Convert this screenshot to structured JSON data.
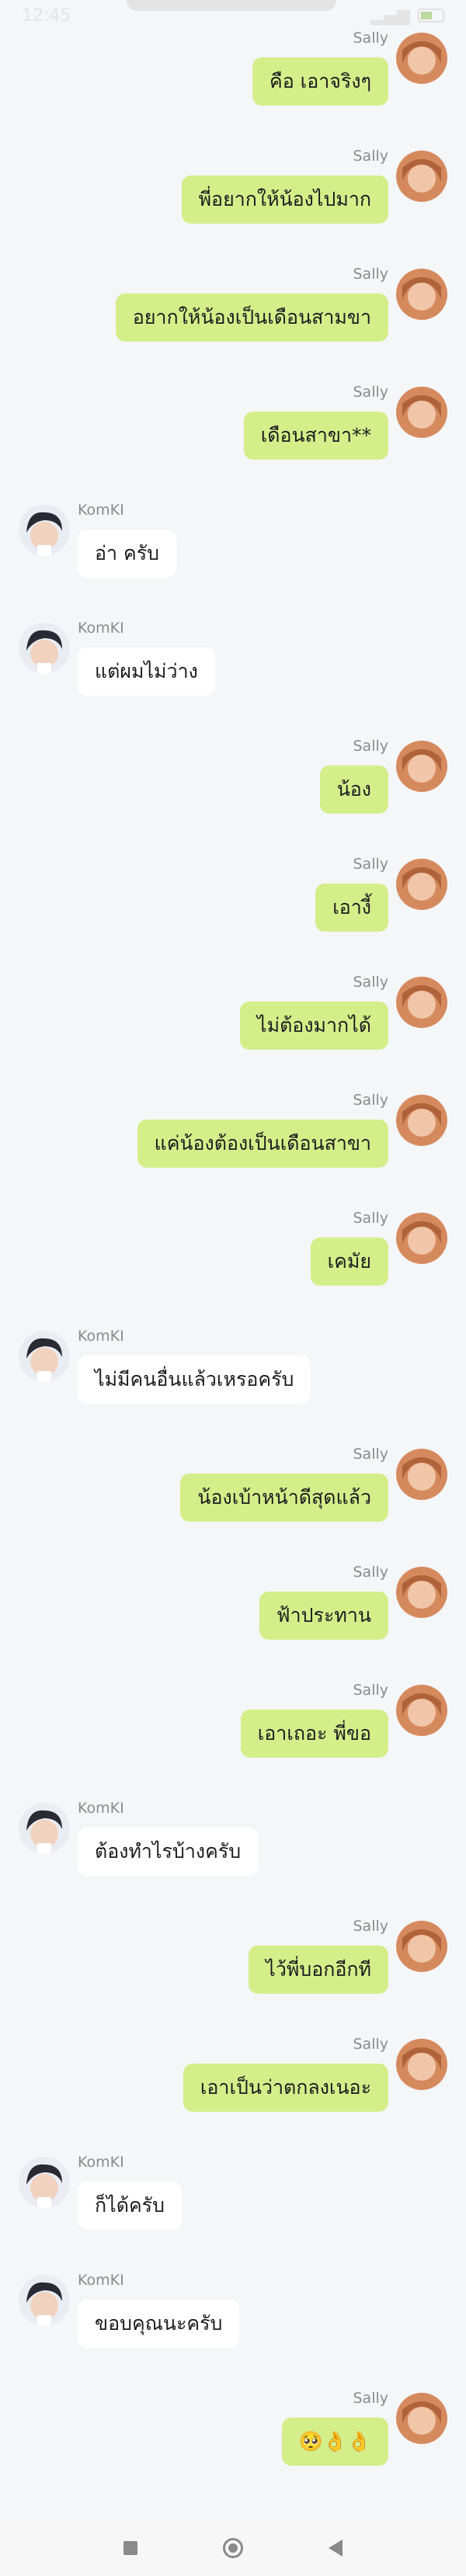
{
  "status_bar": {
    "time": "12:45",
    "right": ""
  },
  "contacts": {
    "sally": "Sally",
    "komki": "KomKI"
  },
  "messages": [
    {
      "side": "right",
      "sender": "Sally",
      "text": "คือ เอาจริงๆ"
    },
    {
      "side": "right",
      "sender": "Sally",
      "text": "พี่อยากให้น้องไปมาก"
    },
    {
      "side": "right",
      "sender": "Sally",
      "text": "อยากให้น้องเป็นเดือนสามขา"
    },
    {
      "side": "right",
      "sender": "Sally",
      "text": "เดือนสาขา**"
    },
    {
      "side": "left",
      "sender": "KomKI",
      "text": "อ่า ครับ"
    },
    {
      "side": "left",
      "sender": "KomKI",
      "text": "แต่ผมไม่ว่าง"
    },
    {
      "side": "right",
      "sender": "Sally",
      "text": "น้อง"
    },
    {
      "side": "right",
      "sender": "Sally",
      "text": "เอางี้"
    },
    {
      "side": "right",
      "sender": "Sally",
      "text": "ไม่ต้องมากได้"
    },
    {
      "side": "right",
      "sender": "Sally",
      "text": "แค่น้องต้องเป็นเดือนสาขา"
    },
    {
      "side": "right",
      "sender": "Sally",
      "text": "เคมัย"
    },
    {
      "side": "left",
      "sender": "KomKI",
      "text": "ไม่มีคนอื่นแล้วเหรอครับ"
    },
    {
      "side": "right",
      "sender": "Sally",
      "text": "น้องเบ้าหน้าดีสุดแล้ว"
    },
    {
      "side": "right",
      "sender": "Sally",
      "text": "ฟ้าประทาน"
    },
    {
      "side": "right",
      "sender": "Sally",
      "text": "เอาเถอะ พี่ขอ"
    },
    {
      "side": "left",
      "sender": "KomKI",
      "text": "ต้องทำไรบ้างครับ"
    },
    {
      "side": "right",
      "sender": "Sally",
      "text": "ไว้พี่บอกอีกที"
    },
    {
      "side": "right",
      "sender": "Sally",
      "text": "เอาเป็นว่าตกลงเนอะ"
    },
    {
      "side": "left",
      "sender": "KomKI",
      "text": "ก็ได้ครับ"
    },
    {
      "side": "left",
      "sender": "KomKI",
      "text": "ขอบคุณนะครับ"
    },
    {
      "side": "right",
      "sender": "Sally",
      "text": "🥺👌👌"
    }
  ],
  "colors": {
    "outgoing_bubble": "#d4ee8a",
    "incoming_bubble": "#ffffff",
    "background": "#f5f6f8"
  },
  "nav": {
    "recent_icon": "square-icon",
    "home_icon": "circle-icon",
    "back_icon": "triangle-back-icon"
  }
}
